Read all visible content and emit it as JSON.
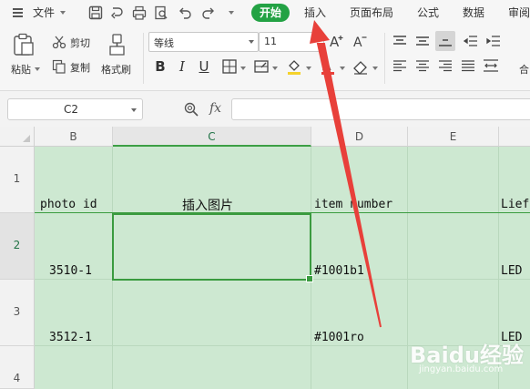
{
  "menubar": {
    "file_label": "文件",
    "tabs": [
      {
        "label": "开始",
        "active": true
      },
      {
        "label": "插入"
      },
      {
        "label": "页面布局"
      },
      {
        "label": "公式"
      },
      {
        "label": "数据"
      },
      {
        "label": "审阅"
      }
    ]
  },
  "ribbon": {
    "paste_label": "粘贴",
    "cut_label": "剪切",
    "copy_label": "复制",
    "format_painter_label": "格式刷",
    "font_name": "等线",
    "font_size": "11",
    "grow_font": "A⁺",
    "shrink_font": "A⁻",
    "bold": "B",
    "italic": "I",
    "underline": "U",
    "merge_label": "合"
  },
  "formula_bar": {
    "name_box": "C2",
    "fx": "fx",
    "formula": ""
  },
  "grid": {
    "columns": [
      "B",
      "C",
      "D",
      "E"
    ],
    "active_column": "C",
    "rows": [
      "1",
      "2",
      "3",
      "4"
    ],
    "active_row": "2",
    "cells": {
      "B1": "photo id",
      "C1": "插入图片",
      "D1": "item number",
      "E1": "",
      "F1": "Lief",
      "B2": "3510-1",
      "D2": "#1001b1",
      "F2": "LED",
      "B3": "3512-1",
      "D3": "#1001ro",
      "F3": "LED"
    }
  },
  "watermark": {
    "line1": "Baidu经验",
    "line2": "jingyan.baidu.com"
  },
  "colors": {
    "accent": "#23a244",
    "sheet_fill": "#cde8d1",
    "selection": "#3a9b3f",
    "annotation_arrow": "#e8403a"
  }
}
